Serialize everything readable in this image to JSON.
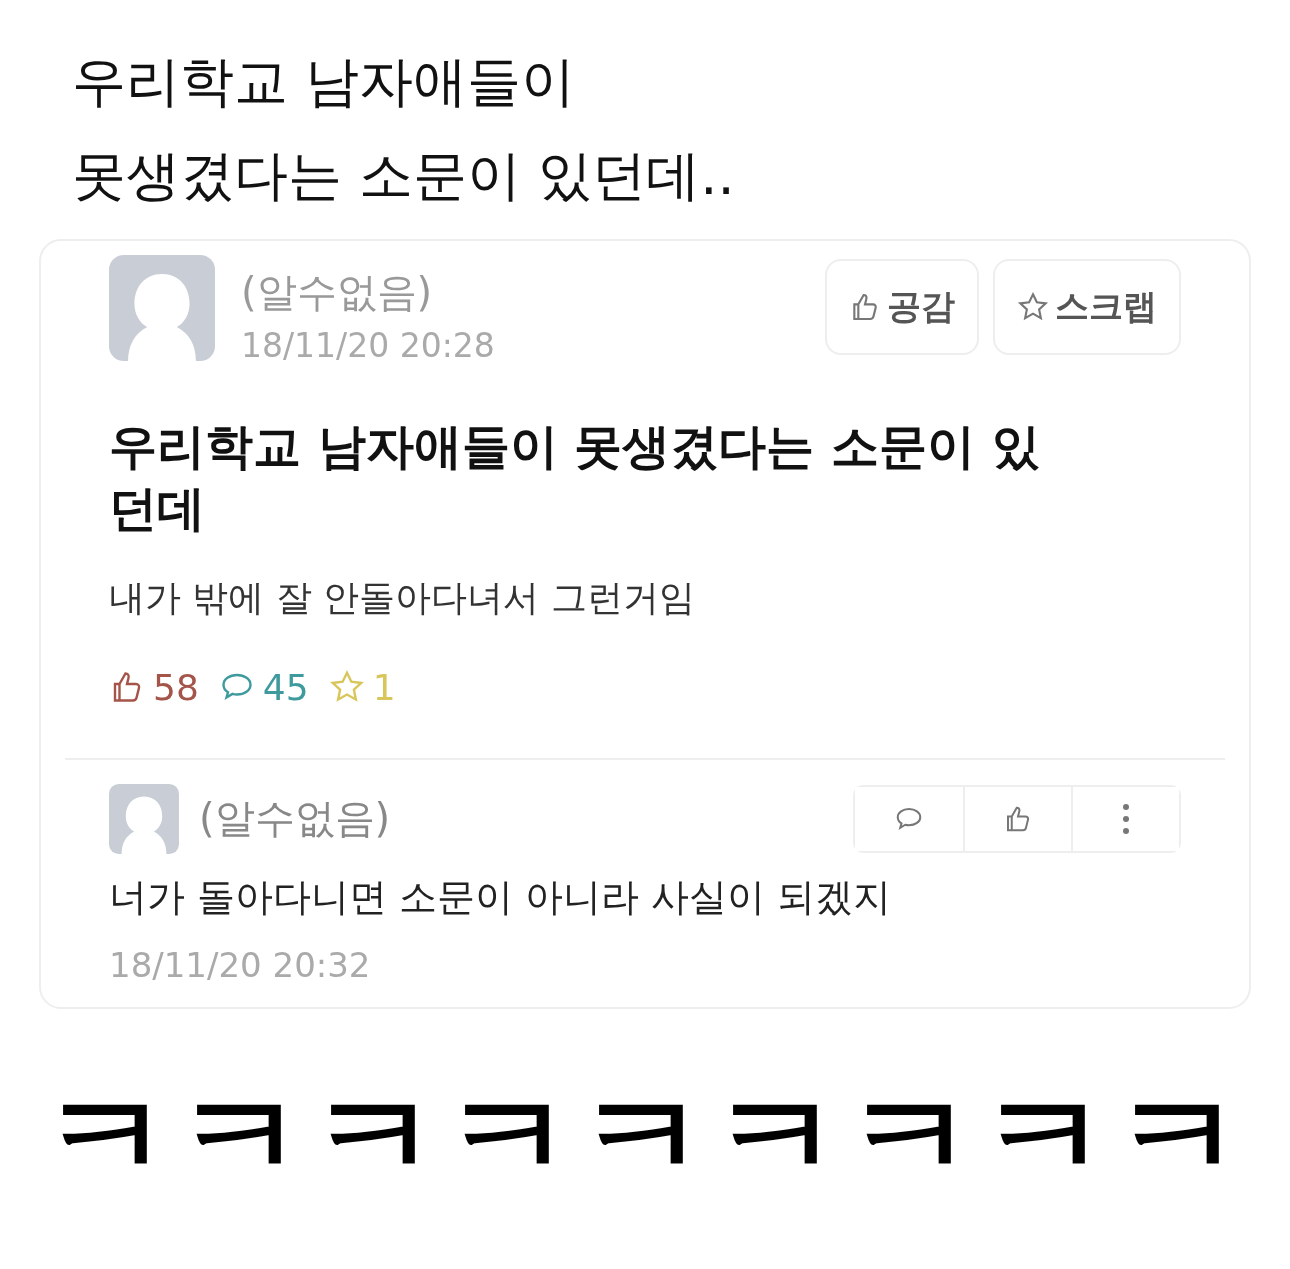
{
  "caption": [
    "우리학교 남자애들이",
    "못생겼다는 소문이 있던데.."
  ],
  "post": {
    "author": "(알수없음)",
    "time": "18/11/20 20:28",
    "actions": [
      {
        "kind": "like",
        "label": "공감"
      },
      {
        "kind": "scrap",
        "label": "스크랩"
      }
    ],
    "title": "우리학교 남자애들이 못생겼다는 소문이 있던데",
    "body": "내가 밖에 잘 안돌아다녀서 그런거임",
    "stats": [
      {
        "kind": "like",
        "count": "58",
        "color": "#a5544a"
      },
      {
        "kind": "comment",
        "count": "45",
        "color": "#3f9a9e"
      },
      {
        "kind": "scrap",
        "count": "1",
        "color": "#d9c65a"
      }
    ]
  },
  "comment": {
    "author": "(알수없음)",
    "text": "너가 돌아다니면 소문이 아니라 사실이 되겠지",
    "time": "18/11/20 20:32",
    "tools": [
      {
        "kind": "reply"
      },
      {
        "kind": "like"
      },
      {
        "kind": "more"
      }
    ]
  },
  "punchline": "ㅋㅋㅋㅋㅋㅋㅋㅋㅋ"
}
